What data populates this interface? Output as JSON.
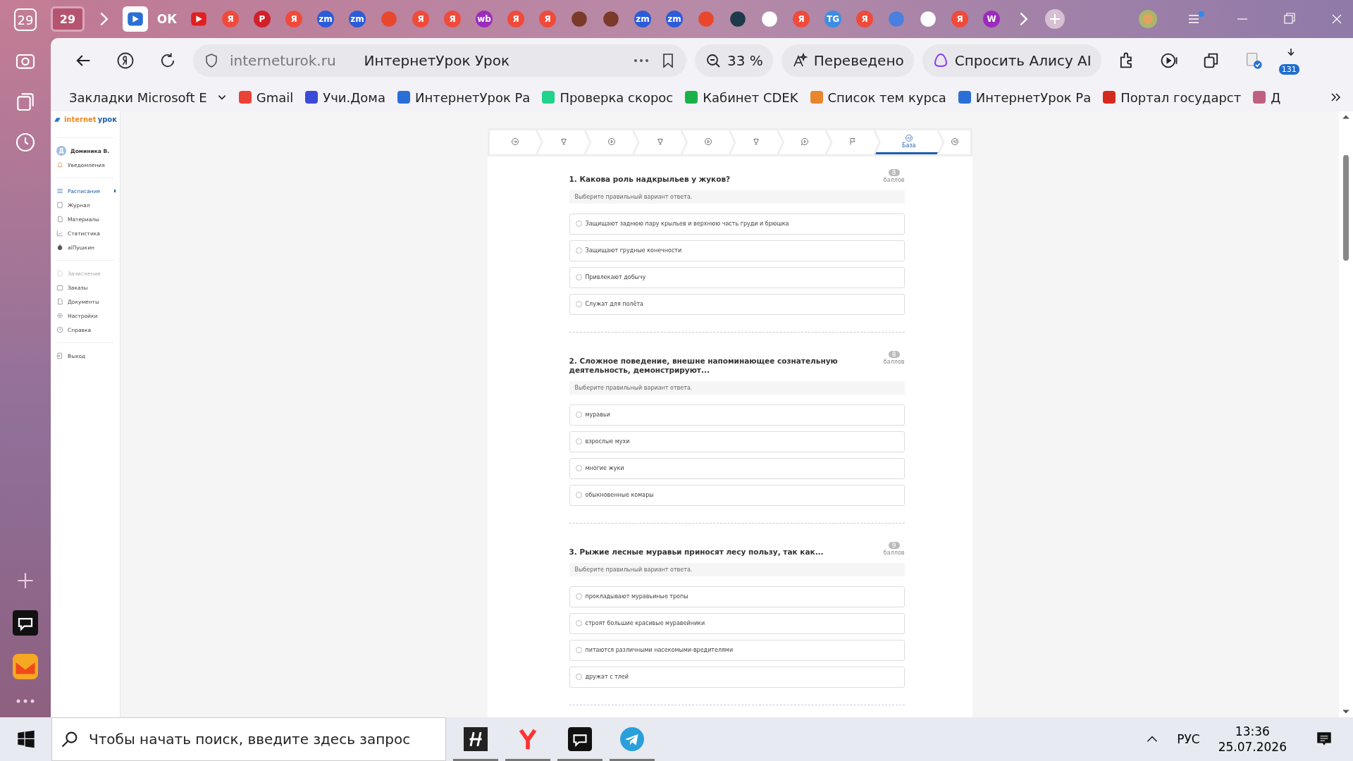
{
  "browser_rail": {
    "calendar_day": "29"
  },
  "tabs": [
    {
      "kind": "group",
      "label": "29",
      "selected": false
    },
    {
      "kind": "chevron",
      "selected": false
    },
    {
      "kind": "play",
      "selected": true
    },
    {
      "kind": "text",
      "label": "ОК",
      "color": "#ffffff",
      "selected": false
    },
    {
      "kind": "play",
      "selected": false
    },
    {
      "kind": "badge",
      "label": "Я",
      "color": "#f04a3a",
      "selected": false
    },
    {
      "kind": "badge",
      "label": "P",
      "color": "#d0202a",
      "selected": false
    },
    {
      "kind": "badge",
      "label": "Я",
      "color": "#f04a3a",
      "selected": false
    },
    {
      "kind": "badge",
      "label": "zm",
      "color": "#2c5bd8",
      "selected": false
    },
    {
      "kind": "badge",
      "label": "zm",
      "color": "#2c5bd8",
      "selected": false
    },
    {
      "kind": "dot",
      "color": "#e8472e",
      "selected": false
    },
    {
      "kind": "badge",
      "label": "Я",
      "color": "#f04a3a",
      "selected": false
    },
    {
      "kind": "badge",
      "label": "Я",
      "color": "#f04a3a",
      "selected": false
    },
    {
      "kind": "badge",
      "label": "wb",
      "color": "#9b2bbd",
      "selected": false
    },
    {
      "kind": "badge",
      "label": "Я",
      "color": "#f04a3a",
      "selected": false
    },
    {
      "kind": "badge",
      "label": "Я",
      "color": "#f04a3a",
      "selected": false
    },
    {
      "kind": "dot",
      "color": "#7a3a2a",
      "selected": false
    },
    {
      "kind": "dot",
      "color": "#7a3a2a",
      "selected": false
    },
    {
      "kind": "badge",
      "label": "zm",
      "color": "#2c5bd8",
      "selected": false
    },
    {
      "kind": "badge",
      "label": "zm",
      "color": "#2c5bd8",
      "selected": false
    },
    {
      "kind": "dot",
      "color": "#e8472e",
      "selected": false
    },
    {
      "kind": "dot",
      "color": "#1d3a4a",
      "selected": false
    },
    {
      "kind": "dot",
      "color": "#ffffff",
      "selected": false
    },
    {
      "kind": "badge",
      "label": "Я",
      "color": "#f04a3a",
      "selected": false
    },
    {
      "kind": "badge",
      "label": "TG",
      "color": "#3a8ee6",
      "selected": false
    },
    {
      "kind": "badge",
      "label": "Я",
      "color": "#f04a3a",
      "selected": false
    },
    {
      "kind": "dot",
      "color": "#4a7fe0",
      "selected": false
    },
    {
      "kind": "dot",
      "color": "#ffffff",
      "selected": false
    },
    {
      "kind": "badge",
      "label": "Я",
      "color": "#f04a3a",
      "selected": false
    },
    {
      "kind": "badge",
      "label": "W",
      "color": "#9b2bbd",
      "selected": false
    },
    {
      "kind": "chevron",
      "selected": false
    },
    {
      "kind": "plus",
      "selected": false
    }
  ],
  "toolbar": {
    "domain": "interneturok.ru",
    "page_title": "ИнтернетУрок Урок",
    "zoom": "33 %",
    "translated": "Переведено",
    "alice": "Спросить Алису AI",
    "downloads_count": "131"
  },
  "bookmarks": [
    {
      "label": "Закладки Microsoft E"
    },
    {
      "label": "Gmail"
    },
    {
      "label": "Учи.Дома"
    },
    {
      "label": "ИнтернетУрок Ра"
    },
    {
      "label": "Проверка скорос"
    },
    {
      "label": "Кабинет CDEK"
    },
    {
      "label": "Список тем курса"
    },
    {
      "label": "ИнтернетУрок Ра"
    },
    {
      "label": "Портал государст"
    },
    {
      "label": "Д"
    }
  ],
  "site": {
    "logo_a": "internet",
    "logo_b": "урок",
    "user": {
      "initial": "Д",
      "name": "Доминика В."
    },
    "menu_groups": [
      [
        {
          "label": "Уведомления",
          "selected": false,
          "disabled": false
        }
      ],
      [
        {
          "label": "Расписание",
          "selected": true,
          "disabled": false
        },
        {
          "label": "Журнал",
          "selected": false,
          "disabled": false
        },
        {
          "label": "Материалы",
          "selected": false,
          "disabled": false
        },
        {
          "label": "Статистика",
          "selected": false,
          "disabled": false
        },
        {
          "label": "aiПушкин",
          "selected": false,
          "disabled": false
        }
      ],
      [
        {
          "label": "Зачисление",
          "selected": false,
          "disabled": true
        },
        {
          "label": "Заказы",
          "selected": false,
          "disabled": false
        },
        {
          "label": "Документы",
          "selected": false,
          "disabled": false
        },
        {
          "label": "Настройки",
          "selected": false,
          "disabled": false
        },
        {
          "label": "Справка",
          "selected": false,
          "disabled": false
        }
      ],
      [
        {
          "label": "Выход",
          "selected": false,
          "disabled": false
        }
      ]
    ]
  },
  "steps": [
    {
      "selected": false
    },
    {
      "selected": false
    },
    {
      "selected": false
    },
    {
      "selected": false
    },
    {
      "selected": false
    },
    {
      "selected": false
    },
    {
      "selected": false
    },
    {
      "selected": false
    },
    {
      "label": "База",
      "selected": true
    },
    {
      "selected": false
    }
  ],
  "questions": [
    {
      "title": "1. Какова роль надкрыльев у жуков?",
      "points": "8",
      "points_label": "баллов",
      "hint": "Выберите правильный вариант ответа.",
      "options": [
        {
          "label": "Защищают заднюю пару крыльев и верхнюю часть груди и брюшка",
          "selected": false
        },
        {
          "label": "Защищают грудные конечности",
          "selected": false
        },
        {
          "label": "Привлекают добычу",
          "selected": false
        },
        {
          "label": "Служат для полёта",
          "selected": false
        }
      ]
    },
    {
      "title": "2. Сложное поведение, внешне напоминающее сознательную деятельность, демонстрируют...",
      "points": "8",
      "points_label": "баллов",
      "hint": "Выберите правильный вариант ответа.",
      "options": [
        {
          "label": "муравьи",
          "selected": false
        },
        {
          "label": "взрослые мухи",
          "selected": false
        },
        {
          "label": "многие жуки",
          "selected": false
        },
        {
          "label": "обыкновенные комары",
          "selected": false
        }
      ]
    },
    {
      "title": "3. Рыжие лесные муравьи приносят лесу пользу, так как...",
      "points": "9",
      "points_label": "баллов",
      "hint": "Выберите правильный вариант ответа.",
      "options": [
        {
          "label": "прокладывают муравьиные тропы",
          "selected": false
        },
        {
          "label": "строят большие красивые муравейники",
          "selected": false
        },
        {
          "label": "питаются различными насекомыми-вредителями",
          "selected": false
        },
        {
          "label": "дружат с тлей",
          "selected": false
        }
      ]
    }
  ],
  "taskbar": {
    "search_placeholder": "Чтобы начать поиск, введите здесь запрос",
    "language": "РУС",
    "time": "13:36",
    "date": "25.07.2026"
  }
}
